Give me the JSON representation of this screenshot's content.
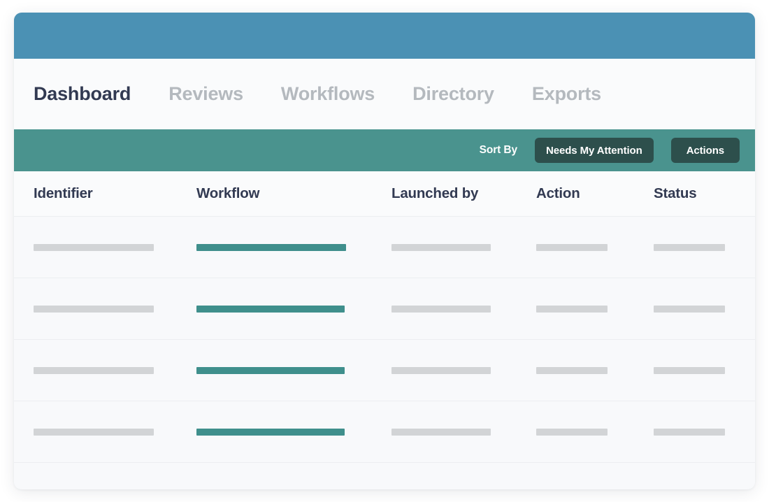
{
  "theme": {
    "brand_bar_color": "#4b91b4",
    "toolbar_color": "#4a938e",
    "button_color": "#2d4f4c",
    "accent_skeleton_color": "#3f8f8c",
    "skeleton_color": "#d2d4d6",
    "active_tab_color": "#323a52",
    "inactive_tab_color": "#b4b9be",
    "card_background": "#f8f9fb"
  },
  "nav": {
    "tabs": [
      {
        "label": "Dashboard",
        "active": true
      },
      {
        "label": "Reviews",
        "active": false
      },
      {
        "label": "Workflows",
        "active": false
      },
      {
        "label": "Directory",
        "active": false
      },
      {
        "label": "Exports",
        "active": false
      }
    ]
  },
  "toolbar": {
    "sort_label": "Sort By",
    "needs_attention_label": "Needs My Attention",
    "actions_label": "Actions"
  },
  "table": {
    "columns": [
      {
        "key": "identifier",
        "label": "Identifier"
      },
      {
        "key": "workflow",
        "label": "Workflow"
      },
      {
        "key": "launched_by",
        "label": "Launched by"
      },
      {
        "key": "action",
        "label": "Action"
      },
      {
        "key": "status",
        "label": "Status"
      }
    ],
    "state": "loading",
    "placeholder_row_count": 4,
    "rows": [
      {
        "identifier": "",
        "workflow": "",
        "launched_by": "",
        "action": "",
        "status": ""
      },
      {
        "identifier": "",
        "workflow": "",
        "launched_by": "",
        "action": "",
        "status": ""
      },
      {
        "identifier": "",
        "workflow": "",
        "launched_by": "",
        "action": "",
        "status": ""
      },
      {
        "identifier": "",
        "workflow": "",
        "launched_by": "",
        "action": "",
        "status": ""
      }
    ]
  }
}
